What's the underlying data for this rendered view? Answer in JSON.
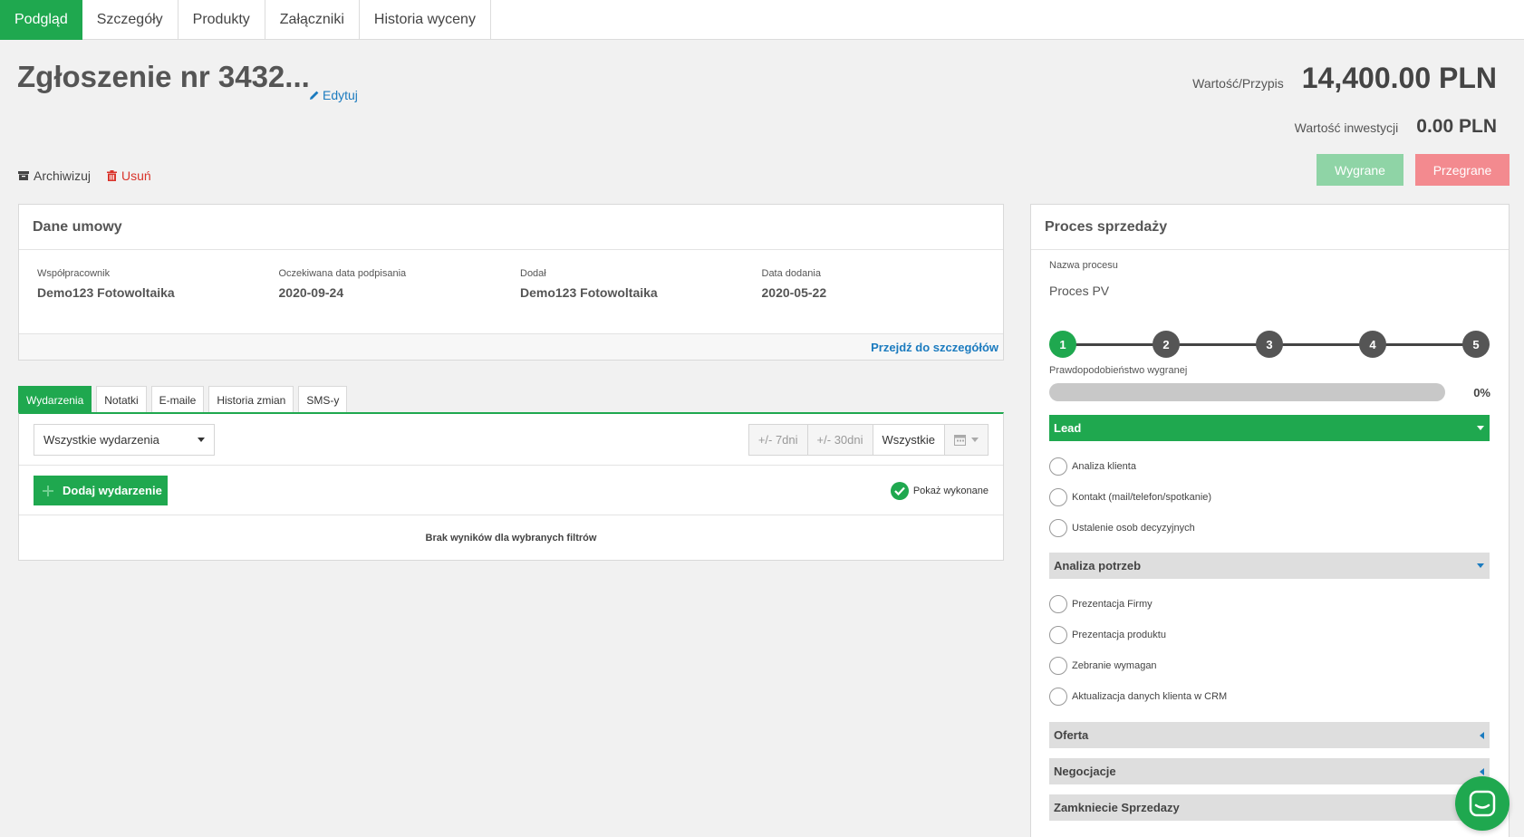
{
  "tabs": [
    "Podgląd",
    "Szczegóły",
    "Produkty",
    "Załączniki",
    "Historia wyceny"
  ],
  "header": {
    "title": "Zgłoszenie nr 3432...",
    "edit_label": "Edytuj",
    "archive_label": "Archiwizuj",
    "delete_label": "Usuń",
    "value_label": "Wartość/Przypis",
    "value": "14,400.00 PLN",
    "investment_label": "Wartość inwestycji",
    "investment_value": "0.00 PLN",
    "won_label": "Wygrane",
    "lost_label": "Przegrane"
  },
  "deal": {
    "title": "Dane umowy",
    "fields": [
      {
        "label": "Współpracownik",
        "value": "Demo123 Fotowoltaika"
      },
      {
        "label": "Oczekiwana data podpisania",
        "value": "2020-09-24"
      },
      {
        "label": "Dodał",
        "value": "Demo123 Fotowoltaika"
      },
      {
        "label": "Data dodania",
        "value": "2020-05-22"
      }
    ],
    "details_link": "Przejdź do szczegółów"
  },
  "sub_tabs": [
    "Wydarzenia",
    "Notatki",
    "E-maile",
    "Historia zmian",
    "SMS-y"
  ],
  "events": {
    "filter_value": "Wszystkie wydarzenia",
    "range_7": "+/- 7dni",
    "range_30": "+/- 30dni",
    "range_all": "Wszystkie",
    "add_label": "Dodaj wydarzenie",
    "show_done_label": "Pokaż wykonane",
    "empty_text": "Brak wyników dla wybranych filtrów"
  },
  "process": {
    "title": "Proces sprzedaży",
    "name_label": "Nazwa procesu",
    "name_value": "Proces PV",
    "steps": [
      "1",
      "2",
      "3",
      "4",
      "5"
    ],
    "active_step": 1,
    "probability_label": "Prawdopodobieństwo wygranej",
    "probability_pct": "0%",
    "probability_value": 0,
    "stages": [
      {
        "name": "Lead",
        "tasks": [
          "Analiza klienta",
          "Kontakt (mail/telefon/spotkanie)",
          "Ustalenie osob decyzyjnych"
        ]
      },
      {
        "name": "Analiza potrzeb",
        "tasks": [
          "Prezentacja Firmy",
          "Prezentacja produktu",
          "Zebranie wymagan",
          "Aktualizacja danych klienta w CRM"
        ]
      },
      {
        "name": "Oferta",
        "tasks": []
      },
      {
        "name": "Negocjacje",
        "tasks": []
      },
      {
        "name": "Zamkniecie Sprzedazy",
        "tasks": []
      }
    ]
  },
  "colors": {
    "accent": "#1fa84f",
    "link": "#1b7bbf",
    "danger": "#d9342b",
    "won": "#8fd4a6",
    "lost": "#f38a8f"
  }
}
